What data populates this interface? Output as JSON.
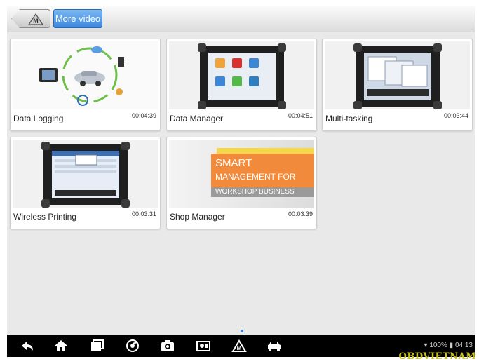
{
  "toolbar": {
    "home_button_letter": "M",
    "more_video_label": "More video"
  },
  "videos": [
    {
      "title": "Data Logging",
      "duration": "00:04:39"
    },
    {
      "title": "Data Manager",
      "duration": "00:04:51"
    },
    {
      "title": "Multi-tasking",
      "duration": "00:03:44"
    },
    {
      "title": "Wireless Printing",
      "duration": "00:03:31"
    },
    {
      "title": "Shop Manager",
      "duration": "00:03:39"
    }
  ],
  "shop_manager_thumb": {
    "line1": "SMART",
    "line2": "MANAGEMENT FOR",
    "line3": "WORKSHOP BUSINESS"
  },
  "navbar": {
    "icons": [
      "back-icon",
      "home-icon",
      "recent-apps-icon",
      "chrome-icon",
      "camera-icon",
      "display-icon",
      "maxisys-home-icon",
      "car-icon"
    ],
    "home_letter": "M",
    "status": "100%",
    "time": "04:13"
  },
  "watermark": "OBDVIETNAM"
}
